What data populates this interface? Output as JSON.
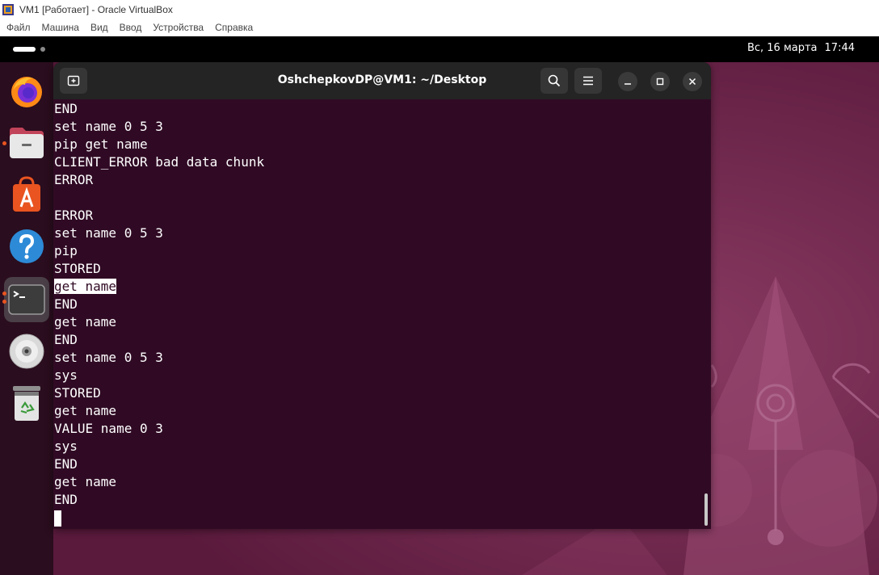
{
  "host_window": {
    "title": "VM1 [Работает] - Oracle VirtualBox",
    "menu": [
      "Файл",
      "Машина",
      "Вид",
      "Ввод",
      "Устройства",
      "Справка"
    ]
  },
  "topbar": {
    "date": "Вс, 16 марта",
    "time": "17:44"
  },
  "dock": {
    "apps": [
      {
        "name": "firefox",
        "icon": "firefox-icon",
        "running": false,
        "active": false
      },
      {
        "name": "files",
        "icon": "folder-icon",
        "running": true,
        "active": false
      },
      {
        "name": "app-center",
        "icon": "app-store-icon",
        "running": false,
        "active": false
      },
      {
        "name": "help",
        "icon": "help-icon",
        "running": false,
        "active": false
      },
      {
        "name": "terminal",
        "icon": "terminal-icon",
        "running": true,
        "active": true
      },
      {
        "name": "disc",
        "icon": "optical-disc-icon",
        "running": false,
        "active": false
      },
      {
        "name": "trash",
        "icon": "trash-icon",
        "running": false,
        "active": false
      }
    ]
  },
  "terminal": {
    "title": "OshchepkovDP@VM1: ~/Desktop",
    "lines": [
      "END",
      "set name 0 5 3",
      "pip get name",
      "CLIENT_ERROR bad data chunk",
      "ERROR",
      "",
      "ERROR",
      "set name 0 5 3",
      "pip",
      "STORED",
      "get name",
      "END",
      "get name",
      "END",
      "set name 0 5 3",
      "sys",
      "STORED",
      "get name",
      "VALUE name 0 3",
      "sys",
      "END",
      "get name",
      "END"
    ],
    "highlighted_line": "get name"
  },
  "colors": {
    "terminal_bg": "#300a24",
    "header_bg": "#242424",
    "accent": "#e95420"
  }
}
